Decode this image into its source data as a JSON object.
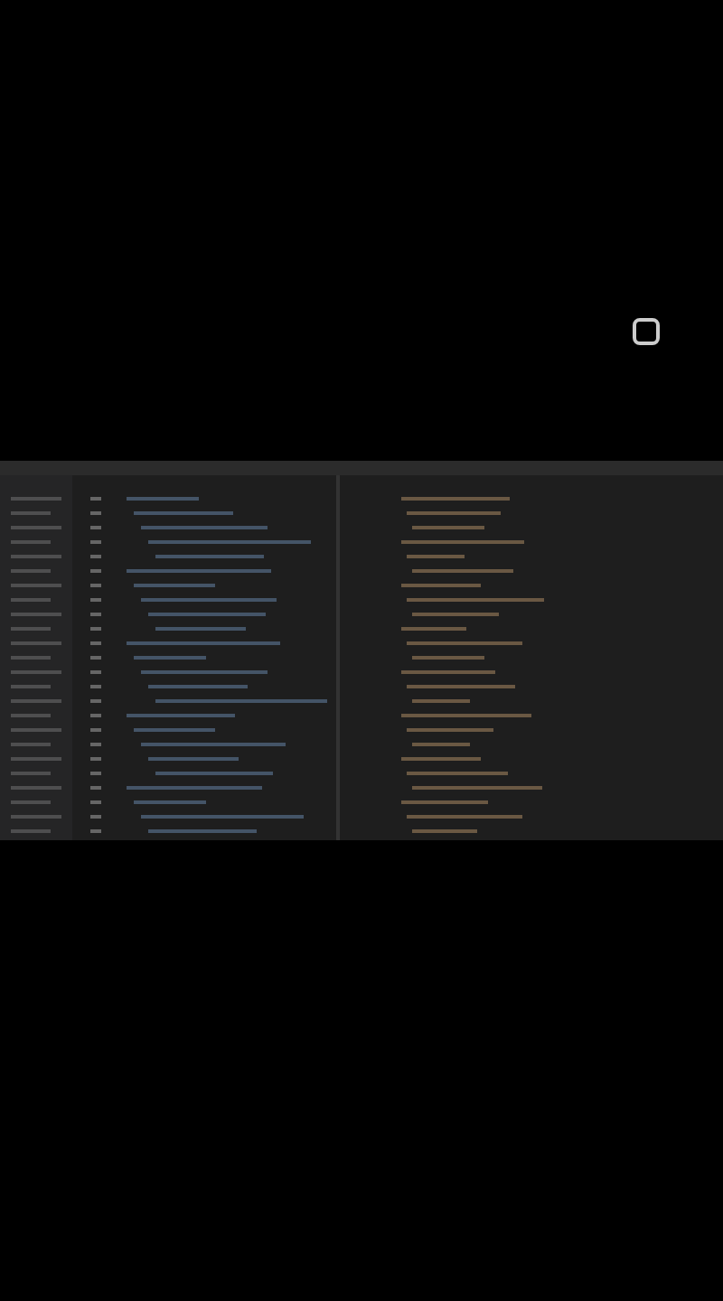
{
  "overlay_buttons": [
    {
      "kind": "square"
    }
  ],
  "video": {
    "kind": "screen-recording"
  }
}
